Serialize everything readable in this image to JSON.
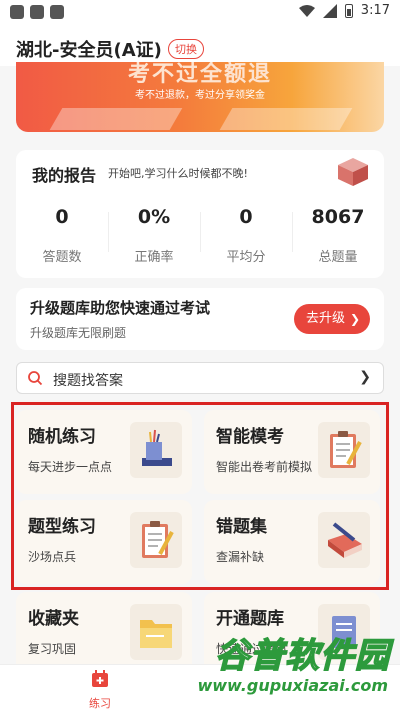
{
  "status_bar": {
    "time": "3:17"
  },
  "header": {
    "title": "湖北-安全员(A证)",
    "switch_label": "切换"
  },
  "banner": {
    "headline": "考不过全额退",
    "subline": "考不过退款，考过分享领奖金"
  },
  "report": {
    "title": "我的报告",
    "subtitle": "开始吧,学习什么时候都不晚!",
    "stats": [
      {
        "value": "0",
        "label": "答题数"
      },
      {
        "value": "0%",
        "label": "正确率"
      },
      {
        "value": "0",
        "label": "平均分"
      },
      {
        "value": "8067",
        "label": "总题量"
      }
    ]
  },
  "upgrade": {
    "title": "升级题库助您快速通过考试",
    "subtitle": "升级题库无限刷题",
    "button_label": "去升级",
    "button_icon": "chevron-right-icon"
  },
  "search": {
    "placeholder": "搜题找答案",
    "icon": "search-icon"
  },
  "tiles": [
    {
      "title": "随机练习",
      "subtitle": "每天进步一点点",
      "icon": "pencil-cup-icon"
    },
    {
      "title": "智能模考",
      "subtitle": "智能出卷考前模拟",
      "icon": "clipboard-pencil-icon"
    },
    {
      "title": "题型练习",
      "subtitle": "沙场点兵",
      "icon": "clipboard-pencil-icon"
    },
    {
      "title": "错题集",
      "subtitle": "查漏补缺",
      "icon": "book-pen-icon"
    },
    {
      "title": "收藏夹",
      "subtitle": "复习巩固",
      "icon": "folder-icon"
    },
    {
      "title": "开通题库",
      "subtitle": "快速通过考试",
      "icon": "document-icon"
    }
  ],
  "tabbar": {
    "practice_label": "练习",
    "practice_icon": "calendar-plus-icon"
  },
  "watermark": {
    "text": "谷普软件园",
    "url": "www.gupuxiazai.com"
  },
  "colors": {
    "accent": "#e8453c",
    "highlight_border": "#d92424",
    "watermark": "#2d9a3c"
  }
}
